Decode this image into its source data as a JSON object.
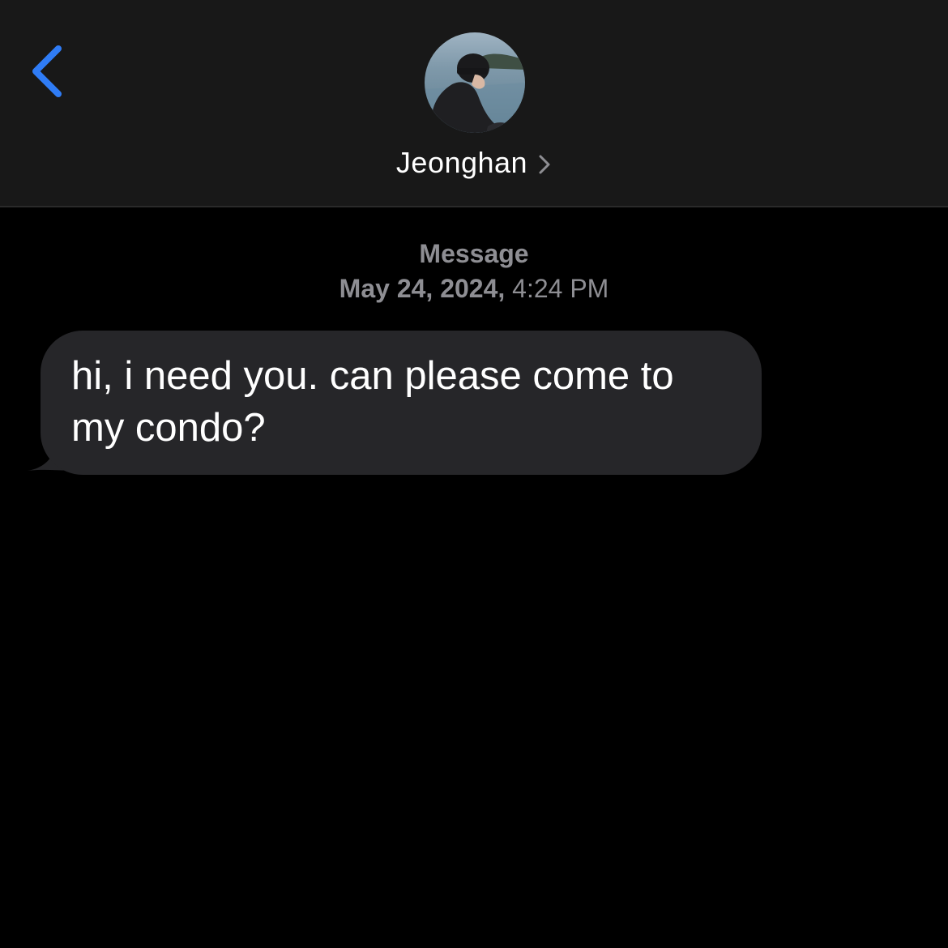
{
  "header": {
    "contact_name": "Jeonghan",
    "back_icon": "chevron-left-icon",
    "detail_icon": "chevron-right-icon"
  },
  "thread": {
    "service_label": "Message",
    "date": "May 24, 2024,",
    "time": "4:24 PM"
  },
  "messages": [
    {
      "direction": "incoming",
      "text": "hi, i need you. can please come to my condo?"
    }
  ],
  "colors": {
    "header_bg": "#181818",
    "background": "#000000",
    "accent": "#2f7cf6",
    "bubble_incoming": "#262629",
    "meta_text": "#8e8e93"
  }
}
